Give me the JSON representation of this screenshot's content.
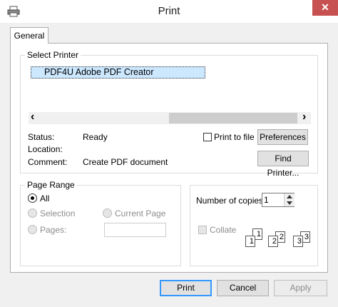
{
  "window": {
    "title": "Print",
    "close_glyph": "✕"
  },
  "tabs": [
    {
      "label": "General"
    }
  ],
  "select_printer": {
    "legend": "Select Printer",
    "printers": [
      {
        "name": "PDF4U Adobe PDF Creator",
        "icon": "printer-icon"
      }
    ],
    "scroll_left": "‹",
    "scroll_right": "›"
  },
  "status": {
    "status_label": "Status:",
    "status_value": "Ready",
    "location_label": "Location:",
    "location_value": "",
    "comment_label": "Comment:",
    "comment_value": "Create PDF document"
  },
  "print_to_file": {
    "label": "Print to file",
    "checked": false
  },
  "buttons": {
    "preferences": "Preferences",
    "find_printer": "Find Printer...",
    "print": "Print",
    "cancel": "Cancel",
    "apply": "Apply"
  },
  "page_range": {
    "legend": "Page Range",
    "all": "All",
    "selection": "Selection",
    "current_page": "Current Page",
    "pages": "Pages:",
    "pages_value": "",
    "selected": "All"
  },
  "copies": {
    "label": "Number of copies:",
    "value": "1",
    "collate": "Collate",
    "collate_checked": false,
    "stack_labels": [
      "1",
      "1",
      "2",
      "2",
      "3",
      "3"
    ]
  },
  "colors": {
    "selection": "#cce8ff",
    "close": "#c75050",
    "default_button": "#3399ff"
  }
}
